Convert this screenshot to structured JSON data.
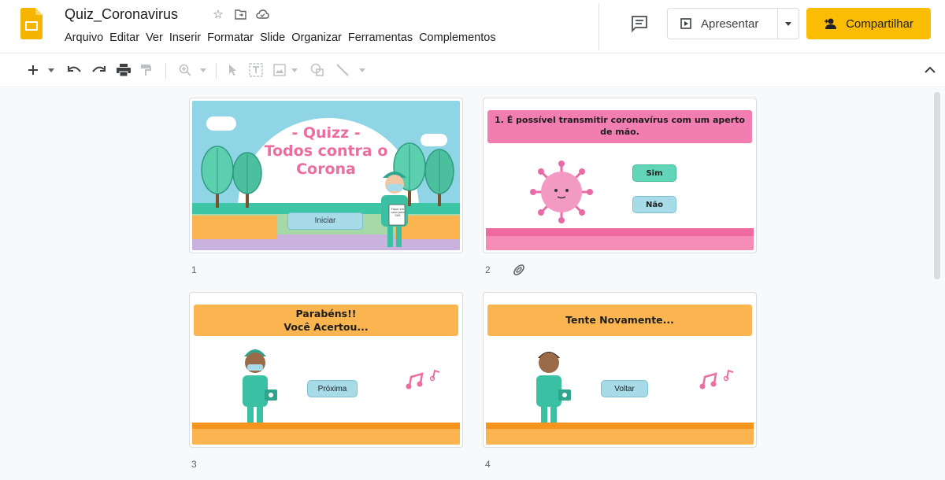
{
  "header": {
    "doc_title": "Quiz_Coronavirus",
    "menu": [
      "Arquivo",
      "Editar",
      "Ver",
      "Inserir",
      "Formatar",
      "Slide",
      "Organizar",
      "Ferramentas",
      "Complementos"
    ],
    "present_label": "Apresentar",
    "share_label": "Compartilhar",
    "share_color": "#fbbc04"
  },
  "slides": [
    {
      "number": "1",
      "title": "- Quizz -\nTodos contra o\nCorona",
      "button": "Iniciar",
      "sign": "Fique em casa pelo SUS"
    },
    {
      "number": "2",
      "question": "1. É possível transmitir coronavírus com um aperto de mão.",
      "options": [
        "Sim",
        "Não"
      ]
    },
    {
      "number": "3",
      "title": "Parabéns!!\nVocê Acertou...",
      "button": "Próxima"
    },
    {
      "number": "4",
      "title": "Tente Novamente...",
      "button": "Voltar"
    }
  ],
  "icons": {
    "logo": "google-slides-icon",
    "star": "star-icon",
    "move": "move-to-folder-icon",
    "cloud": "cloud-status-icon",
    "comment": "comments-icon",
    "present": "present-icon",
    "share": "person-add-icon"
  }
}
